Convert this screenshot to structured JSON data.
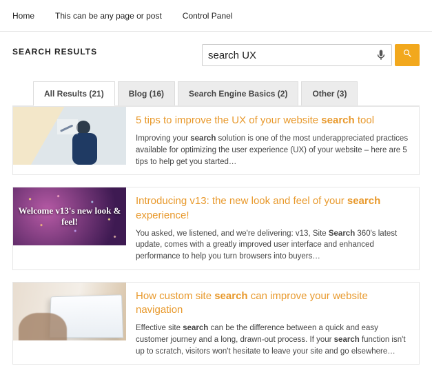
{
  "nav": {
    "home": "Home",
    "any": "This can be any page or post",
    "control": "Control Panel"
  },
  "page_title": "SEARCH RESULTS",
  "search": {
    "value": "search UX"
  },
  "tabs": {
    "all": "All Results (21)",
    "blog": "Blog (16)",
    "basics": "Search Engine Basics (2)",
    "other": "Other (3)"
  },
  "results": [
    {
      "title_a": "5 tips to improve the UX of your website ",
      "title_bold": "search",
      "title_b": " tool",
      "snippet_a": "Improving your ",
      "snippet_bold1": "search",
      "snippet_b": " solution is one of the most underappreciated practices available for optimizing the user experience (UX) of your website – here are 5 tips to help get you started…"
    },
    {
      "thumb_text": "Welcome v13's new look & feel!",
      "title_a": "Introducing v13: the new look and feel of your ",
      "title_bold": "search",
      "title_b": " experience!",
      "snippet_a": "You asked, we listened, and we're delivering: v13, Site ",
      "snippet_bold1": "Search",
      "snippet_b": " 360's latest update, comes with a greatly improved user interface and enhanced performance to help you turn browsers into buyers…"
    },
    {
      "title_a": "How custom site ",
      "title_bold": "search",
      "title_b": " can improve your website navigation",
      "snippet_a": "Effective site ",
      "snippet_bold1": "search",
      "snippet_b": " can be the difference between a quick and easy customer journey and a long, drawn-out process. If your ",
      "snippet_bold2": "search",
      "snippet_c": " function isn't up to scratch, visitors won't hesitate to leave your site and go elsewhere…"
    }
  ]
}
